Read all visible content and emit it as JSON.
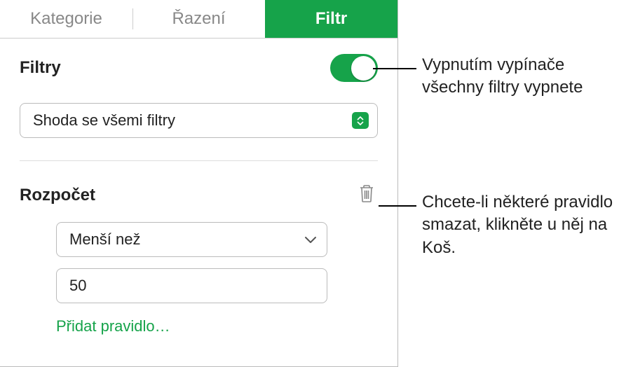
{
  "tabs": {
    "category": "Kategorie",
    "sort": "Řazení",
    "filter": "Filtr"
  },
  "filters": {
    "title": "Filtry",
    "match_mode": "Shoda se všemi filtry"
  },
  "rule": {
    "column": "Rozpočet",
    "operator": "Menší než",
    "value": "50",
    "add": "Přidat pravidlo…"
  },
  "callouts": {
    "toggle": "Vypnutím vypínače všechny filtry vypnete",
    "trash": "Chcete-li některé pravidlo smazat, klikněte u něj na Koš."
  }
}
